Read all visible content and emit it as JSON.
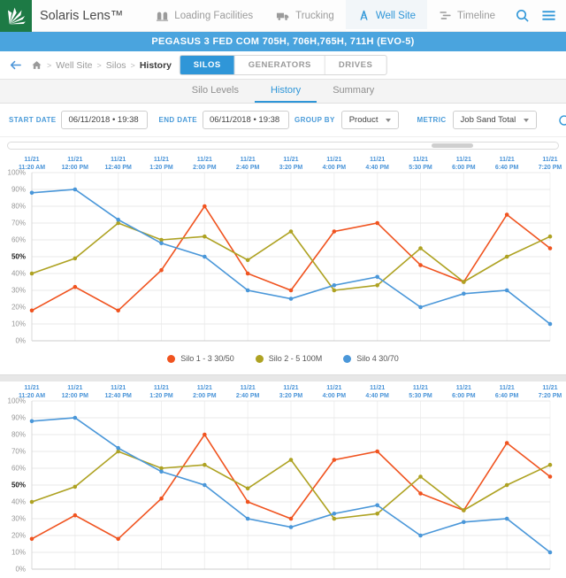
{
  "colors": {
    "accent": "#2f96d8",
    "banner_blue": "#4aa4de",
    "logo_green": "#1d7a45",
    "link_blue": "#4a94d8"
  },
  "header": {
    "title": "Solaris Lens™",
    "nav": [
      {
        "label": "Loading Facilities",
        "active": false
      },
      {
        "label": "Trucking",
        "active": false
      },
      {
        "label": "Well Site",
        "active": true
      },
      {
        "label": "Timeline",
        "active": false
      }
    ]
  },
  "banner": {
    "title": "PEGASUS 3 FED COM 705H, 706H,765H, 711H (EVO-5)"
  },
  "breadcrumb": {
    "separator": ">",
    "items": [
      "Well Site",
      "Silos",
      "History"
    ]
  },
  "tabs": {
    "items": [
      {
        "label": "SILOS"
      },
      {
        "label": "GENERATORS"
      },
      {
        "label": "DRIVES"
      }
    ]
  },
  "subtabs": {
    "items": [
      {
        "label": "Silo Levels"
      },
      {
        "label": "History"
      },
      {
        "label": "Summary"
      }
    ]
  },
  "filters": {
    "start_date_label": "START DATE",
    "start_date_value": "06/11/2018 • 19:38",
    "end_date_label": "END DATE",
    "end_date_value": "06/11/2018 • 19:38",
    "group_by_label": "GROUP BY",
    "group_by_value": "Product",
    "metric_label": "METRIC",
    "metric_value": "Job Sand Total"
  },
  "chart_data": [
    {
      "type": "line",
      "title": "",
      "xlabel": "",
      "ylabel": "",
      "ylim": [
        0,
        100
      ],
      "ytick_step": 10,
      "ytick_suffix": "%",
      "emphasized_ytick": 50,
      "grid": true,
      "legend_position": "bottom",
      "categories": [
        [
          "11/21",
          "11:20 AM"
        ],
        [
          "11/21",
          "12:00 PM"
        ],
        [
          "11/21",
          "12:40 PM"
        ],
        [
          "11/21",
          "1:20 PM"
        ],
        [
          "11/21",
          "2:00 PM"
        ],
        [
          "11/21",
          "2:40 PM"
        ],
        [
          "11/21",
          "3:20 PM"
        ],
        [
          "11/21",
          "4:00 PM"
        ],
        [
          "11/21",
          "4:40 PM"
        ],
        [
          "11/21",
          "5:30 PM"
        ],
        [
          "11/21",
          "6:00 PM"
        ],
        [
          "11/21",
          "6:40 PM"
        ],
        [
          "11/21",
          "7:20 PM"
        ]
      ],
      "series": [
        {
          "name": "Silo 1 - 3 30/50",
          "color": "#f0531f",
          "values": [
            18,
            32,
            18,
            42,
            80,
            40,
            30,
            65,
            70,
            45,
            35,
            75,
            55
          ]
        },
        {
          "name": "Silo 2 - 5 100M",
          "color": "#aea222",
          "values": [
            40,
            49,
            70,
            60,
            62,
            48,
            65,
            30,
            33,
            55,
            35,
            50,
            62
          ]
        },
        {
          "name": "Silo 4 30/70",
          "color": "#4a97d9",
          "values": [
            88,
            90,
            72,
            58,
            50,
            30,
            25,
            33,
            38,
            20,
            28,
            30,
            10
          ]
        }
      ]
    },
    {
      "type": "line",
      "title": "",
      "xlabel": "",
      "ylabel": "",
      "ylim": [
        0,
        100
      ],
      "ytick_step": 10,
      "ytick_suffix": "%",
      "emphasized_ytick": 50,
      "grid": true,
      "legend_position": "bottom",
      "partial": true,
      "categories": [
        [
          "11/21",
          "11:20 AM"
        ],
        [
          "11/21",
          "12:00 PM"
        ],
        [
          "11/21",
          "12:40 PM"
        ],
        [
          "11/21",
          "1:20 PM"
        ],
        [
          "11/21",
          "2:00 PM"
        ],
        [
          "11/21",
          "2:40 PM"
        ],
        [
          "11/21",
          "3:20 PM"
        ],
        [
          "11/21",
          "4:00 PM"
        ],
        [
          "11/21",
          "4:40 PM"
        ],
        [
          "11/21",
          "5:30 PM"
        ],
        [
          "11/21",
          "6:00 PM"
        ],
        [
          "11/21",
          "6:40 PM"
        ],
        [
          "11/21",
          "7:20 PM"
        ]
      ],
      "series": [
        {
          "name": "Silo 1 - 3 30/50",
          "color": "#f0531f",
          "values": [
            18,
            32,
            18,
            42,
            80,
            40,
            30,
            65,
            70,
            45,
            35,
            75,
            55
          ]
        },
        {
          "name": "Silo 2 - 5 100M",
          "color": "#aea222",
          "values": [
            40,
            49,
            70,
            60,
            62,
            48,
            65,
            30,
            33,
            55,
            35,
            50,
            62
          ]
        },
        {
          "name": "Silo 4 30/70",
          "color": "#4a97d9",
          "values": [
            88,
            90,
            72,
            58,
            50,
            30,
            25,
            33,
            38,
            20,
            28,
            30,
            10
          ]
        }
      ]
    }
  ]
}
